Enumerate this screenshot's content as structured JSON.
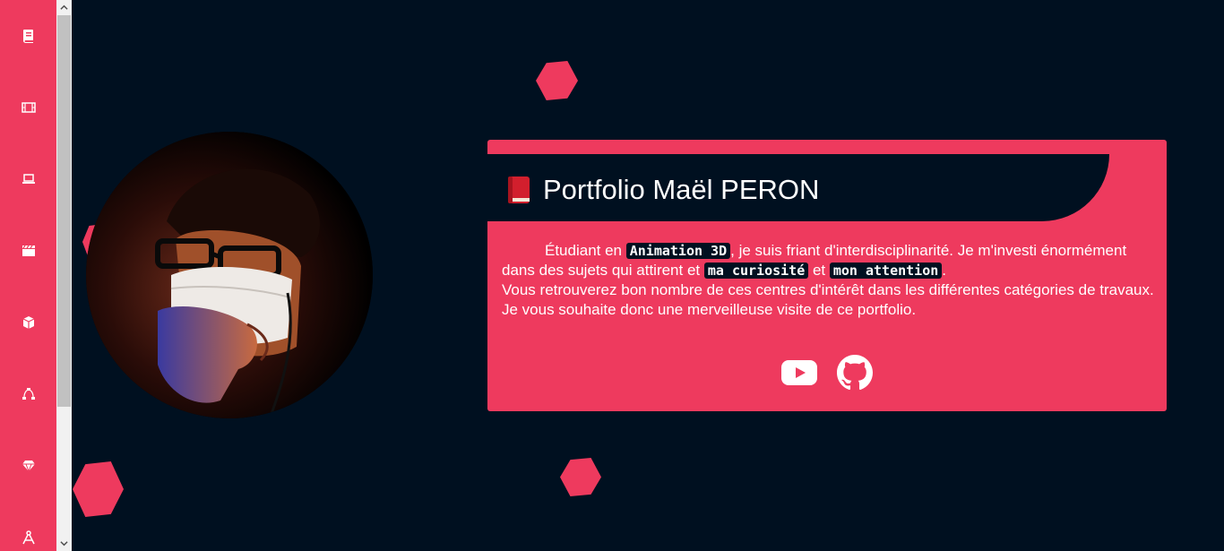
{
  "sidebar": {
    "items": [
      {
        "icon": "book-icon"
      },
      {
        "icon": "film-icon"
      },
      {
        "icon": "laptop-icon"
      },
      {
        "icon": "clapperboard-icon"
      },
      {
        "icon": "cube-icon"
      },
      {
        "icon": "bezier-curve-icon"
      },
      {
        "icon": "gem-icon"
      },
      {
        "icon": "compass-drafting-icon"
      }
    ]
  },
  "colors": {
    "accent": "#ee3a5e",
    "background": "#001020",
    "text": "#ffffff"
  },
  "profile": {
    "avatar_icon": "portrait-photo"
  },
  "card": {
    "title_emoji_icon": "red-book-icon",
    "title": "Portfolio Maël PERON",
    "bio": {
      "part1": "Étudiant en ",
      "code1": "Animation 3D",
      "part2": ", je suis friant d'interdisciplinarité. Je m'investi énormément dans des sujets qui attirent et ",
      "code2": "ma curiosité",
      "part3": " et ",
      "code3": "mon attention",
      "part4": ".",
      "line2": "Vous retrouverez bon nombre de ces centres d'intérêt dans les différentes catégories de travaux.",
      "line3": "Je vous souhaite donc une merveilleuse visite de ce portfolio."
    },
    "socials": [
      {
        "icon": "youtube-icon"
      },
      {
        "icon": "github-icon"
      }
    ]
  }
}
